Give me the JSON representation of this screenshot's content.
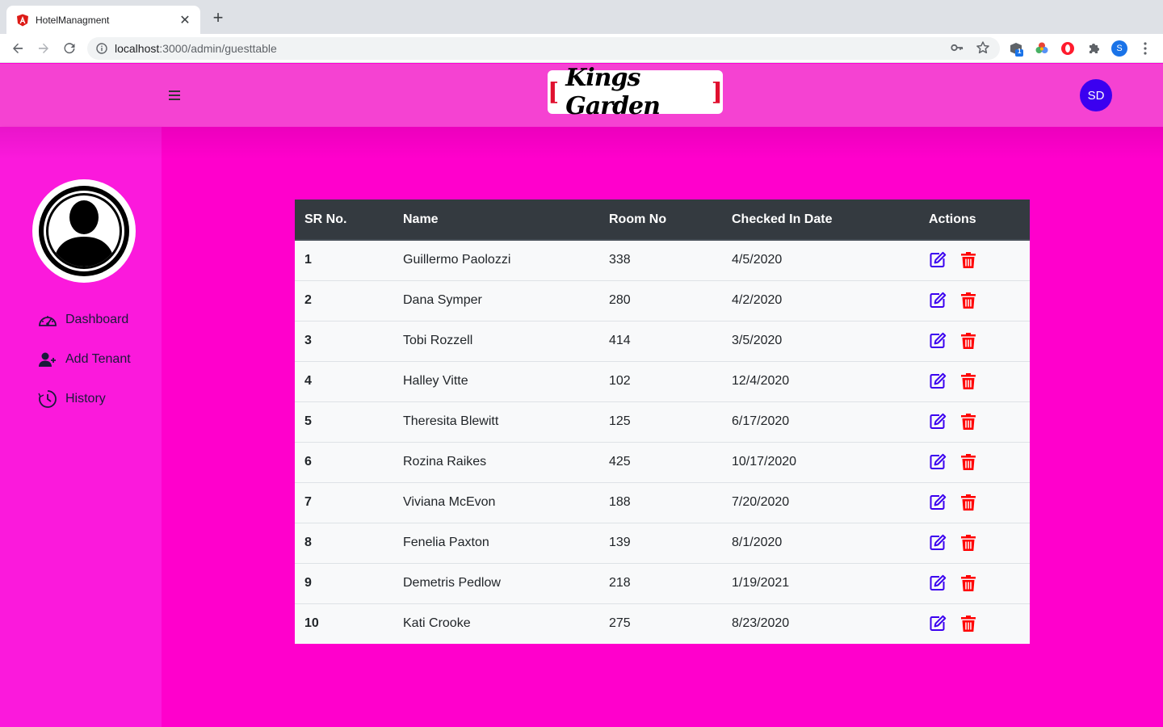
{
  "browser": {
    "tab_title": "HotelManagment",
    "url_host": "localhost",
    "url_path": ":3000/admin/guesttable",
    "extension_badge": "1",
    "profile_initial": "S"
  },
  "header": {
    "logo_bracket_open": "[",
    "logo_text": "Kings Garden",
    "logo_bracket_close": "]",
    "avatar_initials": "SD"
  },
  "sidebar": {
    "items": [
      {
        "label": "Dashboard",
        "icon": "speedometer-icon"
      },
      {
        "label": "Add Tenant",
        "icon": "add-user-icon"
      },
      {
        "label": "History",
        "icon": "clock-icon"
      }
    ]
  },
  "table": {
    "headers": [
      "SR No.",
      "Name",
      "Room No",
      "Checked In Date",
      "Actions"
    ],
    "rows": [
      {
        "sr": "1",
        "name": "Guillermo Paolozzi",
        "room": "338",
        "date": "4/5/2020"
      },
      {
        "sr": "2",
        "name": "Dana Symper",
        "room": "280",
        "date": "4/2/2020"
      },
      {
        "sr": "3",
        "name": "Tobi Rozzell",
        "room": "414",
        "date": "3/5/2020"
      },
      {
        "sr": "4",
        "name": "Halley Vitte",
        "room": "102",
        "date": "12/4/2020"
      },
      {
        "sr": "5",
        "name": "Theresita Blewitt",
        "room": "125",
        "date": "6/17/2020"
      },
      {
        "sr": "6",
        "name": "Rozina Raikes",
        "room": "425",
        "date": "10/17/2020"
      },
      {
        "sr": "7",
        "name": "Viviana McEvon",
        "room": "188",
        "date": "7/20/2020"
      },
      {
        "sr": "8",
        "name": "Fenelia Paxton",
        "room": "139",
        "date": "8/1/2020"
      },
      {
        "sr": "9",
        "name": "Demetris Pedlow",
        "room": "218",
        "date": "1/19/2021"
      },
      {
        "sr": "10",
        "name": "Kati Crooke",
        "room": "275",
        "date": "8/23/2020"
      }
    ]
  },
  "colors": {
    "header_bg": "#f542d2",
    "main_bg": "#ff00cc",
    "edit_icon": "#3b00f0",
    "delete_icon": "#ff0000",
    "table_head": "#343a40"
  }
}
